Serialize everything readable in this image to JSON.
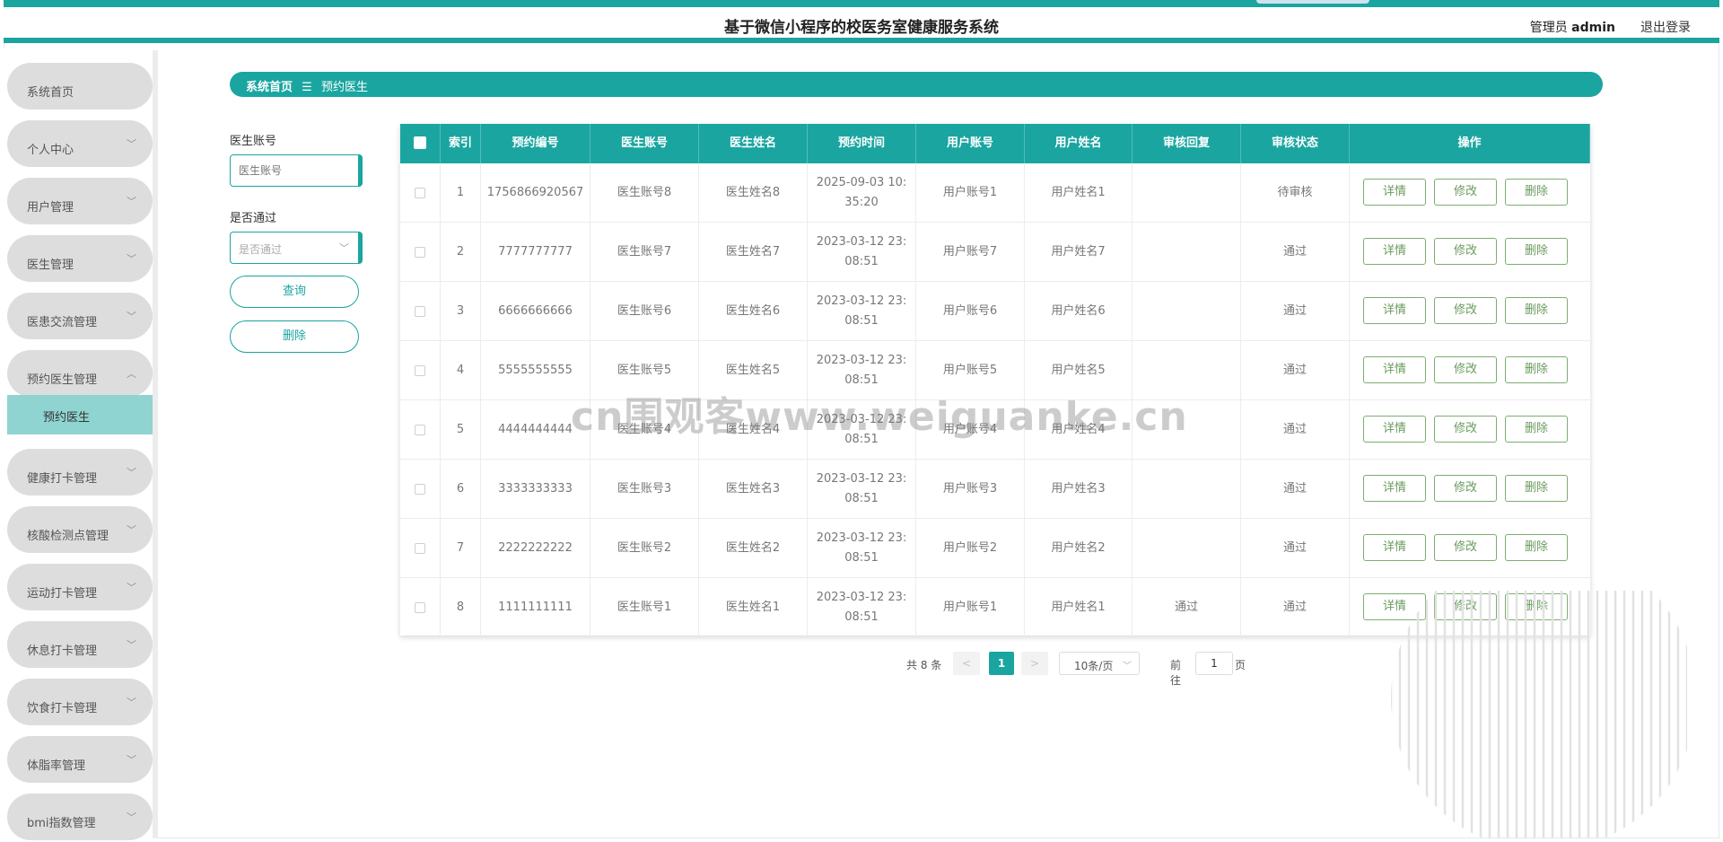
{
  "header": {
    "title": "基于微信小程序的校医务室健康服务系统",
    "user_role": "管理员",
    "username": "admin",
    "logout": "退出登录"
  },
  "sidebar": {
    "items": [
      {
        "label": "系统首页",
        "chevron": false
      },
      {
        "label": "个人中心",
        "chevron": true
      },
      {
        "label": "用户管理",
        "chevron": true
      },
      {
        "label": "医生管理",
        "chevron": true
      },
      {
        "label": "医患交流管理",
        "chevron": true
      },
      {
        "label": "预约医生管理",
        "chevron": true,
        "expanded": true
      },
      {
        "label": "健康打卡管理",
        "chevron": true
      },
      {
        "label": "核酸检测点管理",
        "chevron": true
      },
      {
        "label": "运动打卡管理",
        "chevron": true
      },
      {
        "label": "休息打卡管理",
        "chevron": true
      },
      {
        "label": "饮食打卡管理",
        "chevron": true
      },
      {
        "label": "体脂率管理",
        "chevron": true
      },
      {
        "label": "bmi指数管理",
        "chevron": true
      }
    ],
    "active_sub": "预约医生"
  },
  "breadcrumb": {
    "home": "系统首页",
    "separator": "☰",
    "current": "预约医生"
  },
  "filters": {
    "doctor_account_label": "医生账号",
    "doctor_account_placeholder": "医生账号",
    "approved_label": "是否通过",
    "approved_placeholder": "是否通过",
    "query_button": "查询",
    "delete_button": "删除"
  },
  "table": {
    "columns": [
      "索引",
      "预约编号",
      "医生账号",
      "医生姓名",
      "预约时间",
      "用户账号",
      "用户姓名",
      "审核回复",
      "审核状态",
      "操作"
    ],
    "action_labels": {
      "detail": "详情",
      "edit": "修改",
      "delete": "删除"
    },
    "rows": [
      {
        "index": "1",
        "appt_no": "1756866920567",
        "doctor_account": "医生账号8",
        "doctor_name": "医生姓名8",
        "time": "2025-09-03 10:35:20",
        "user_account": "用户账号1",
        "user_name": "用户姓名1",
        "reply": "",
        "status": "待审核"
      },
      {
        "index": "2",
        "appt_no": "7777777777",
        "doctor_account": "医生账号7",
        "doctor_name": "医生姓名7",
        "time": "2023-03-12 23:08:51",
        "user_account": "用户账号7",
        "user_name": "用户姓名7",
        "reply": "",
        "status": "通过"
      },
      {
        "index": "3",
        "appt_no": "6666666666",
        "doctor_account": "医生账号6",
        "doctor_name": "医生姓名6",
        "time": "2023-03-12 23:08:51",
        "user_account": "用户账号6",
        "user_name": "用户姓名6",
        "reply": "",
        "status": "通过"
      },
      {
        "index": "4",
        "appt_no": "5555555555",
        "doctor_account": "医生账号5",
        "doctor_name": "医生姓名5",
        "time": "2023-03-12 23:08:51",
        "user_account": "用户账号5",
        "user_name": "用户姓名5",
        "reply": "",
        "status": "通过"
      },
      {
        "index": "5",
        "appt_no": "4444444444",
        "doctor_account": "医生账号4",
        "doctor_name": "医生姓名4",
        "time": "2023-03-12 23:08:51",
        "user_account": "用户账号4",
        "user_name": "用户姓名4",
        "reply": "",
        "status": "通过"
      },
      {
        "index": "6",
        "appt_no": "3333333333",
        "doctor_account": "医生账号3",
        "doctor_name": "医生姓名3",
        "time": "2023-03-12 23:08:51",
        "user_account": "用户账号3",
        "user_name": "用户姓名3",
        "reply": "",
        "status": "通过"
      },
      {
        "index": "7",
        "appt_no": "2222222222",
        "doctor_account": "医生账号2",
        "doctor_name": "医生姓名2",
        "time": "2023-03-12 23:08:51",
        "user_account": "用户账号2",
        "user_name": "用户姓名2",
        "reply": "",
        "status": "通过"
      },
      {
        "index": "8",
        "appt_no": "1111111111",
        "doctor_account": "医生账号1",
        "doctor_name": "医生姓名1",
        "time": "2023-03-12 23:08:51",
        "user_account": "用户账号1",
        "user_name": "用户姓名1",
        "reply": "通过",
        "status": "通过"
      }
    ]
  },
  "pagination": {
    "total": "共 8 条",
    "prev": "<",
    "page": "1",
    "next": ">",
    "page_size": "10条/页",
    "goto_prefix": "前往",
    "goto_value": "1",
    "goto_suffix": "页"
  },
  "watermark": "cn围观客www.weiguanke.cn",
  "colors": {
    "accent": "#1aa5a0",
    "active_submenu": "#8fd4d0",
    "menu_bg": "#dddddd",
    "action_border": "#7dad72"
  }
}
